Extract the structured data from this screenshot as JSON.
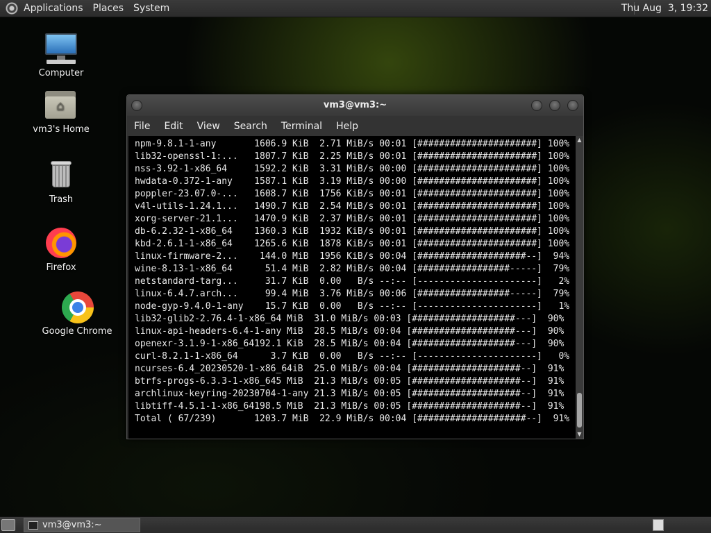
{
  "top_panel": {
    "menus": [
      "Applications",
      "Places",
      "System"
    ],
    "clock": "Thu Aug  3, 19:32"
  },
  "desktop_icons": [
    {
      "label": "Computer",
      "icon": "computer-icon"
    },
    {
      "label": "vm3's Home",
      "icon": "home-folder-icon"
    },
    {
      "label": "Trash",
      "icon": "trash-icon"
    },
    {
      "label": "Firefox",
      "icon": "firefox-icon"
    },
    {
      "label": "Google Chrome",
      "icon": "chrome-icon"
    }
  ],
  "terminal": {
    "title": "vm3@vm3:~",
    "menu": [
      "File",
      "Edit",
      "View",
      "Search",
      "Terminal",
      "Help"
    ],
    "lines": [
      "npm-9.8.1-1-any       1606.9 KiB  2.71 MiB/s 00:01 [######################] 100%",
      "lib32-openssl-1:...   1807.7 KiB  2.25 MiB/s 00:01 [######################] 100%",
      "nss-3.92-1-x86_64     1592.2 KiB  3.31 MiB/s 00:00 [######################] 100%",
      "hwdata-0.372-1-any    1587.1 KiB  3.19 MiB/s 00:00 [######################] 100%",
      "poppler-23.07.0-...   1608.7 KiB  1756 KiB/s 00:01 [######################] 100%",
      "v4l-utils-1.24.1...   1490.7 KiB  2.54 MiB/s 00:01 [######################] 100%",
      "xorg-server-21.1...   1470.9 KiB  2.37 MiB/s 00:01 [######################] 100%",
      "db-6.2.32-1-x86_64    1360.3 KiB  1932 KiB/s 00:01 [######################] 100%",
      "kbd-2.6.1-1-x86_64    1265.6 KiB  1878 KiB/s 00:01 [######################] 100%",
      "linux-firmware-2...    144.0 MiB  1956 KiB/s 00:04 [####################--]  94%",
      "wine-8.13-1-x86_64      51.4 MiB  2.82 MiB/s 00:04 [#################-----]  79%",
      "netstandard-targ...     31.7 KiB  0.00   B/s --:-- [----------------------]   2%",
      "linux-6.4.7.arch...     99.4 MiB  3.76 MiB/s 00:06 [#################-----]  79%",
      "node-gyp-9.4.0-1-any    15.7 KiB  0.00   B/s --:-- [----------------------]   1%",
      "lib32-glib2-2.76.4-1-x86_64 MiB  31.0 MiB/s 00:03 [###################---]  90%",
      "linux-api-headers-6.4-1-any MiB  28.5 MiB/s 00:04 [###################---]  90%",
      "openexr-3.1.9-1-x86_64192.1 KiB  28.5 MiB/s 00:04 [###################---]  90%",
      "curl-8.2.1-1-x86_64      3.7 KiB  0.00   B/s --:-- [----------------------]   0%",
      "ncurses-6.4_20230520-1-x86_64iB  25.0 MiB/s 00:04 [####################--]  91%",
      "btrfs-progs-6.3.3-1-x86_645 MiB  21.3 MiB/s 00:05 [####################--]  91%",
      "archlinux-keyring-20230704-1-any 21.3 MiB/s 00:05 [####################--]  91%",
      "libtiff-4.5.1-1-x86_64198.5 MiB  21.3 MiB/s 00:05 [####################--]  91%",
      "Total ( 67/239)       1203.7 MiB  22.9 MiB/s 00:04 [####################--]  91%"
    ]
  },
  "taskbar": {
    "task_label": "vm3@vm3:~"
  }
}
